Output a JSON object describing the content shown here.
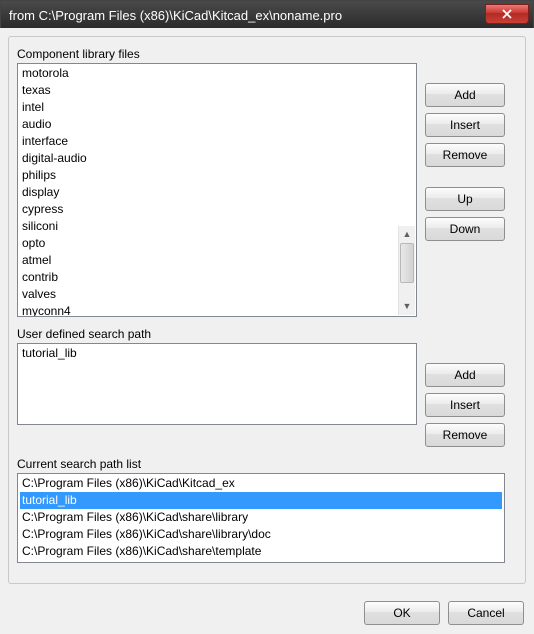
{
  "window": {
    "title": "from C:\\Program Files (x86)\\KiCad\\Kitcad_ex\\noname.pro"
  },
  "labels": {
    "component_library_files": "Component library files",
    "user_defined_search_path": "User defined search path",
    "current_search_path_list": "Current search path list"
  },
  "buttons": {
    "add": "Add",
    "insert": "Insert",
    "remove": "Remove",
    "up": "Up",
    "down": "Down",
    "ok": "OK",
    "cancel": "Cancel"
  },
  "component_libraries": [
    "motorola",
    "texas",
    "intel",
    "audio",
    "interface",
    "digital-audio",
    "philips",
    "display",
    "cypress",
    "siliconi",
    "opto",
    "atmel",
    "contrib",
    "valves",
    "myconn4"
  ],
  "user_paths": [
    "tutorial_lib"
  ],
  "search_paths": [
    {
      "text": "C:\\Program Files (x86)\\KiCad\\Kitcad_ex",
      "selected": false
    },
    {
      "text": "tutorial_lib",
      "selected": true
    },
    {
      "text": "C:\\Program Files (x86)\\KiCad\\share\\library",
      "selected": false
    },
    {
      "text": "C:\\Program Files (x86)\\KiCad\\share\\library\\doc",
      "selected": false
    },
    {
      "text": "C:\\Program Files (x86)\\KiCad\\share\\template",
      "selected": false
    }
  ]
}
